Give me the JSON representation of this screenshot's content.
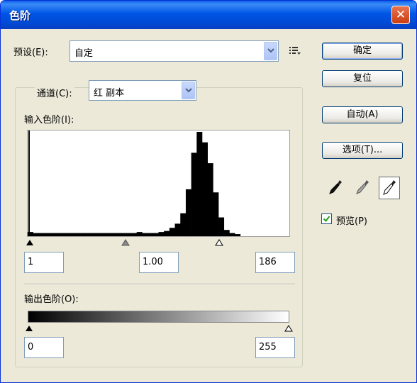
{
  "window": {
    "title": "色阶"
  },
  "preset": {
    "label": "预设(E):",
    "value": "自定"
  },
  "channel": {
    "label": "通道(C):",
    "value": "红 副本"
  },
  "input_levels": {
    "label": "输入色阶(I):",
    "black": "1",
    "gamma": "1.00",
    "white": "186"
  },
  "output_levels": {
    "label": "输出色阶(O):",
    "black": "0",
    "white": "255"
  },
  "buttons": {
    "ok": "确定",
    "reset": "复位",
    "auto": "自动(A)",
    "options": "选项(T)..."
  },
  "preview": {
    "label": "预览(P)",
    "checked": true
  },
  "histogram": {
    "note": "relative heights of the histogram bins across the 0–255 input range",
    "bins": [
      0.04,
      0.03,
      0.03,
      0.03,
      0.03,
      0.03,
      0.03,
      0.03,
      0.03,
      0.03,
      0.03,
      0.03,
      0.03,
      0.03,
      0.03,
      0.03,
      0.03,
      0.03,
      0.03,
      0.03,
      0.04,
      0.03,
      0.03,
      0.03,
      0.04,
      0.05,
      0.08,
      0.12,
      0.22,
      0.45,
      0.8,
      1.0,
      0.9,
      0.7,
      0.42,
      0.18,
      0.06,
      0.03,
      0.02,
      0.0,
      0.0,
      0.0,
      0.0,
      0.0,
      0.0,
      0.0,
      0.0,
      0.0
    ]
  },
  "colors": {
    "title_bar": "#0055e5",
    "dialog_bg": "#ece9d8",
    "close_button": "#d95b2e"
  }
}
